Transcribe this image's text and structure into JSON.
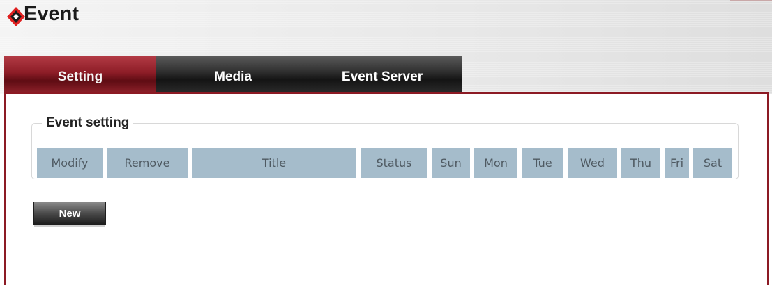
{
  "header": {
    "title": "Event"
  },
  "tabs": [
    {
      "label": "Setting",
      "active": true
    },
    {
      "label": "Media",
      "active": false
    },
    {
      "label": "Event Server",
      "active": false
    }
  ],
  "event_setting": {
    "legend": "Event setting",
    "columns": [
      "Modify",
      "Remove",
      "Title",
      "Status",
      "Sun",
      "Mon",
      "Tue",
      "Wed",
      "Thu",
      "Fri",
      "Sat"
    ],
    "rows": []
  },
  "actions": {
    "new_label": "New"
  },
  "colors": {
    "accent_red": "#8c1a24",
    "tab_active": "#9b2731",
    "tab_inactive": "#2c2c2c",
    "header_cell": "#a5bccb"
  }
}
